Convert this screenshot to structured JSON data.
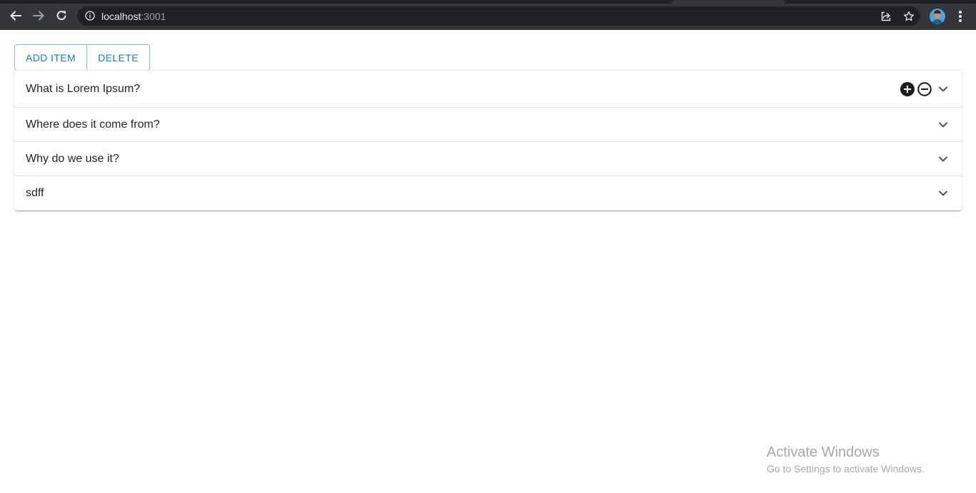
{
  "browser": {
    "url_host": "localhost",
    "url_port": ":3001"
  },
  "toolbar": {
    "add_label": "ADD ITEM",
    "delete_label": "DELETE"
  },
  "accordion": {
    "items": [
      {
        "label": "What is Lorem Ipsum?",
        "expanded_actions": true
      },
      {
        "label": "Where does it come from?",
        "expanded_actions": false
      },
      {
        "label": "Why do we use it?",
        "expanded_actions": false
      },
      {
        "label": "sdff",
        "expanded_actions": false
      }
    ]
  },
  "watermark": {
    "title": "Activate Windows",
    "subtitle": "Go to Settings to activate Windows."
  },
  "colors": {
    "primary": "#1976d2",
    "chrome_bg": "#35363a",
    "omnibox_bg": "#202124"
  },
  "icons": {
    "back": "arrow-left-icon",
    "forward": "arrow-right-icon",
    "reload": "reload-icon",
    "info": "info-icon",
    "share": "share-icon",
    "bookmark": "star-icon",
    "menu": "kebab-menu-icon",
    "add": "add-circle-icon",
    "remove": "remove-circle-icon",
    "expand": "chevron-down-icon"
  }
}
